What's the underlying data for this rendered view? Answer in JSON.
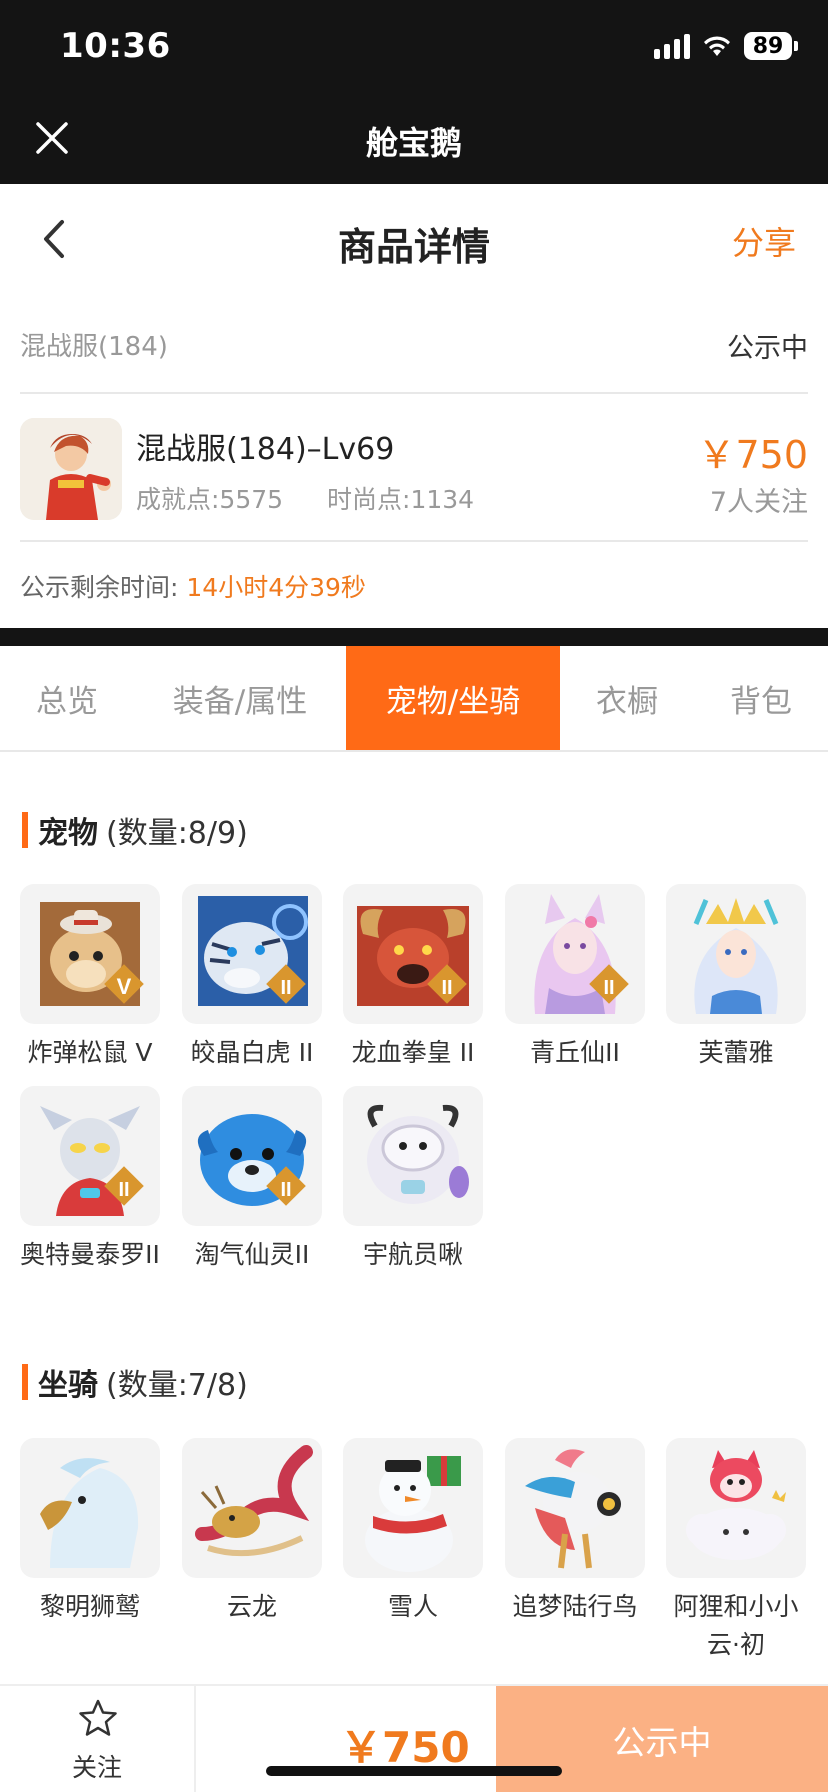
{
  "status": {
    "time": "10:36",
    "battery": "89"
  },
  "app": {
    "title": "舱宝鹅"
  },
  "page": {
    "title": "商品详情",
    "share": "分享"
  },
  "server": {
    "name": "混战服(184)",
    "status": "公示中"
  },
  "product": {
    "title": "混战服(184)–Lv69",
    "achievement": "成就点:5575",
    "fashion": "时尚点:1134",
    "price": "￥750",
    "followers": "7人关注"
  },
  "countdown": {
    "label": "公示剩余时间:",
    "value": "14小时4分39秒"
  },
  "tabs": [
    "总览",
    "装备/属性",
    "宠物/坐骑",
    "衣橱",
    "背包"
  ],
  "active_tab": "宠物/坐骑",
  "pets": {
    "title": "宠物",
    "count": "(数量:8/9)",
    "items": [
      {
        "name": "炸弹松鼠 V",
        "icon": "squirrel-pet-icon"
      },
      {
        "name": "皎晶白虎 II",
        "icon": "white-tiger-pet-icon"
      },
      {
        "name": "龙血拳皇 II",
        "icon": "dragon-boxer-pet-icon"
      },
      {
        "name": "青丘仙II",
        "icon": "fox-fairy-pet-icon"
      },
      {
        "name": "芙蕾雅",
        "icon": "freya-pet-icon"
      },
      {
        "name": "奥特曼泰罗II",
        "icon": "ultraman-pet-icon"
      },
      {
        "name": "淘气仙灵II",
        "icon": "blue-spirit-pet-icon"
      },
      {
        "name": "宇航员啾",
        "icon": "astronaut-pet-icon"
      }
    ]
  },
  "mounts": {
    "title": "坐骑",
    "count": "(数量:7/8)",
    "items": [
      {
        "name": "黎明狮鹫",
        "icon": "griffin-mount-icon"
      },
      {
        "name": "云龙",
        "icon": "cloud-dragon-mount-icon"
      },
      {
        "name": "雪人",
        "icon": "snowman-mount-icon"
      },
      {
        "name": "追梦陆行鸟",
        "icon": "dream-bird-mount-icon"
      },
      {
        "name": "阿狸和小小云·初",
        "icon": "ali-cloud-mount-icon"
      }
    ]
  },
  "bottom": {
    "follow": "关注",
    "price": "￥750",
    "action": "公示中"
  },
  "colors": {
    "accent": "#ff6a16",
    "price": "#f07a1e",
    "action_bg": "#fbb184",
    "header_bg": "#141414"
  }
}
